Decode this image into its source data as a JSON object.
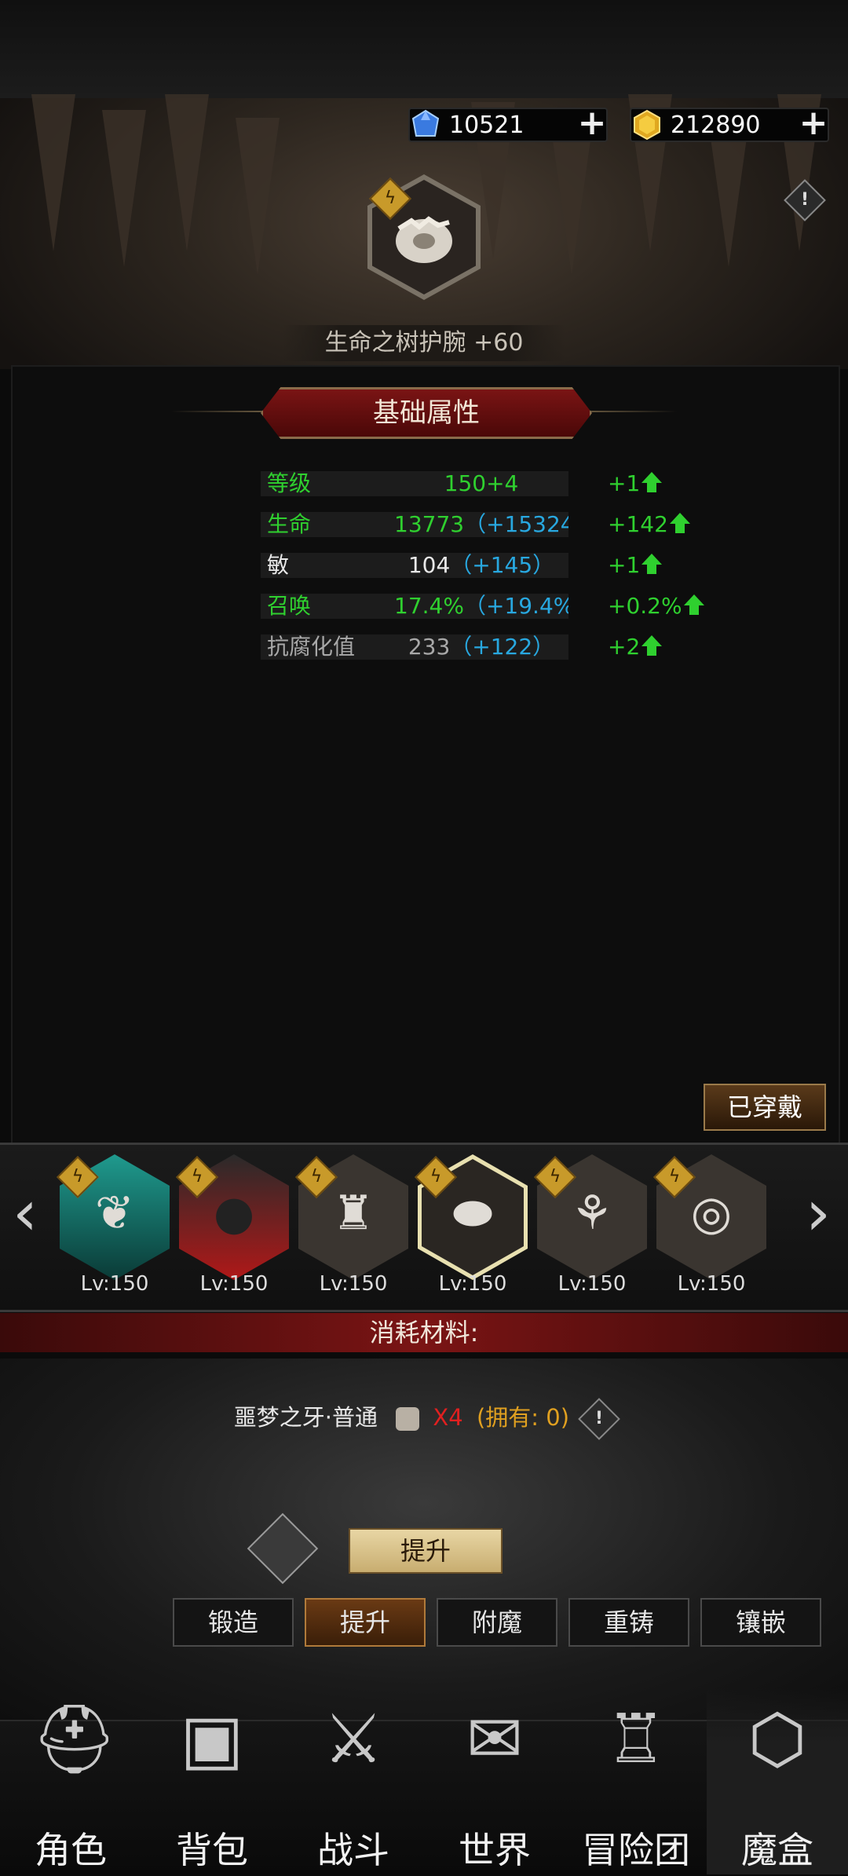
{
  "currency": {
    "gems": "10521",
    "gold": "212890"
  },
  "item": {
    "name": "生命之树护腕 +60"
  },
  "section_title": "基础属性",
  "stats": [
    {
      "label": "等级",
      "value": "150+4",
      "bonus": "",
      "increase": "+1"
    },
    {
      "label": "生命",
      "value": "13773",
      "bonus": "（+15324",
      "increase": "+142"
    },
    {
      "label": "敏",
      "value": "104",
      "bonus": "（+145）",
      "increase": "+1"
    },
    {
      "label": "召唤",
      "value": "17.4%",
      "bonus": "（+19.4%",
      "increase": "+0.2%"
    },
    {
      "label": "抗腐化值",
      "value": "233",
      "bonus": "（+122）",
      "increase": "+2"
    }
  ],
  "equipped_label": "已穿戴",
  "equipment": [
    {
      "level": "Lv:150",
      "icon": "necklace-icon"
    },
    {
      "level": "Lv:150",
      "icon": "bear-helmet-icon"
    },
    {
      "level": "Lv:150",
      "icon": "armor-icon"
    },
    {
      "level": "Lv:150",
      "icon": "bracer-icon"
    },
    {
      "level": "Lv:150",
      "icon": "boots-icon"
    },
    {
      "level": "Lv:150",
      "icon": "ring-icon"
    }
  ],
  "materials_title": "消耗材料:",
  "material": {
    "name": "噩梦之牙·普通",
    "qty": "X4",
    "owned": "(拥有: 0)"
  },
  "upgrade_button": "提升",
  "tabs": [
    "锻造",
    "提升",
    "附魔",
    "重铸",
    "镶嵌"
  ],
  "active_tab": "提升",
  "nav": [
    "角色",
    "背包",
    "战斗",
    "世界",
    "冒险团",
    "魔盒"
  ],
  "colors": {
    "stat_green": "#2fd02f",
    "stat_blue": "#28a8e0",
    "banner_red": "#7a1414"
  }
}
